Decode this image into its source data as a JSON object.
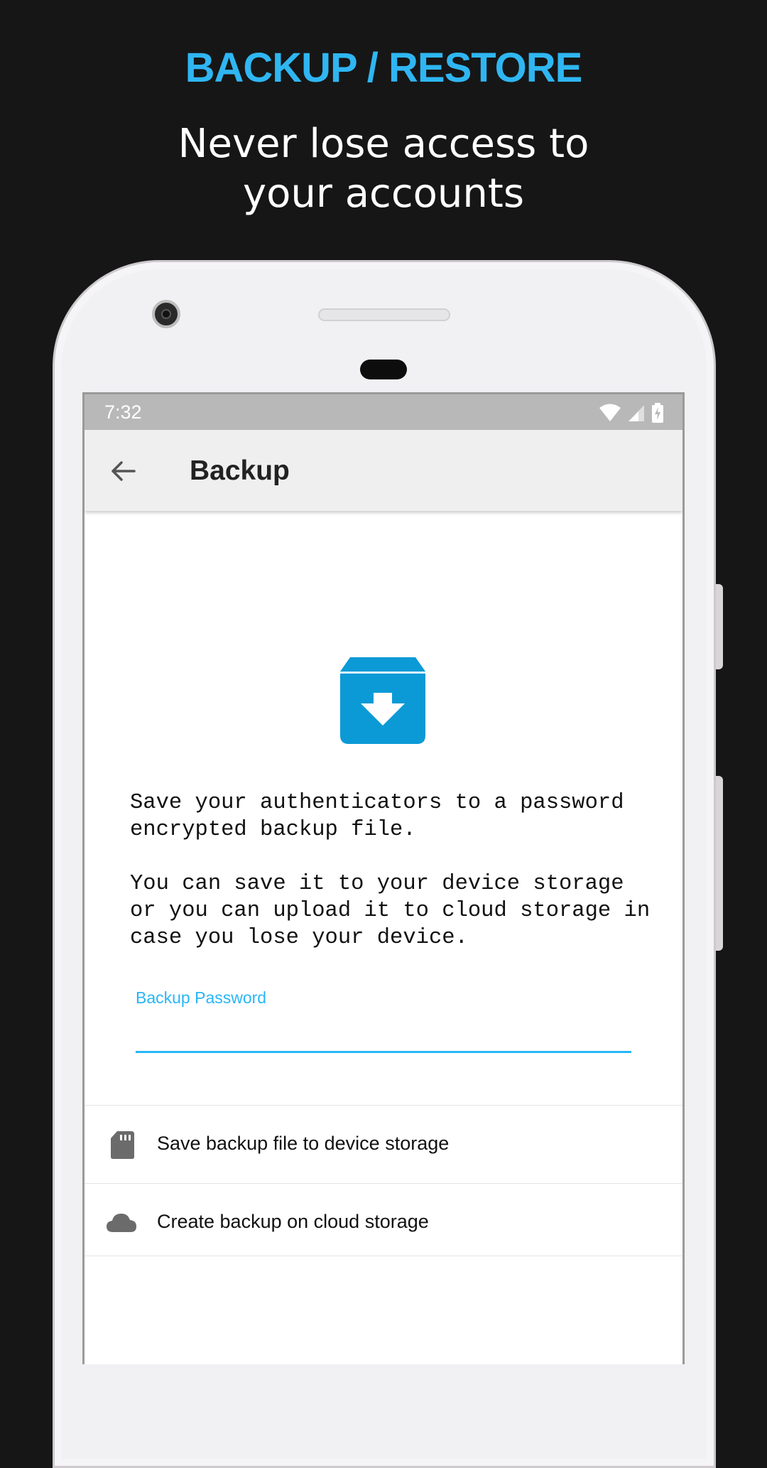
{
  "promo": {
    "title": "BACKUP / RESTORE",
    "subtitle_line1": "Never lose access to",
    "subtitle_line2": "your accounts"
  },
  "status_bar": {
    "time": "7:32",
    "icons": [
      "wifi-icon",
      "cell-signal-icon",
      "battery-charging-icon"
    ]
  },
  "app_bar": {
    "title": "Backup",
    "back_icon": "arrow-back-icon"
  },
  "content": {
    "hero_icon": "archive-download-icon",
    "description_p1": "Save your authenticators to a password encrypted backup file.",
    "description_p2": "You can save it to your device storage or you can upload it to cloud storage in case you lose your device.",
    "password_label": "Backup Password",
    "password_value": ""
  },
  "actions": [
    {
      "icon": "sd-card-icon",
      "label": "Save backup file to device storage"
    },
    {
      "icon": "cloud-icon",
      "label": "Create backup on cloud storage"
    }
  ],
  "colors": {
    "accent": "#29b6f6",
    "promo_title": "#2fb6f2",
    "hero_icon": "#0b9ad6",
    "background": "#161616",
    "app_bar": "#efefef",
    "status_bar": "#b8b8b8"
  }
}
